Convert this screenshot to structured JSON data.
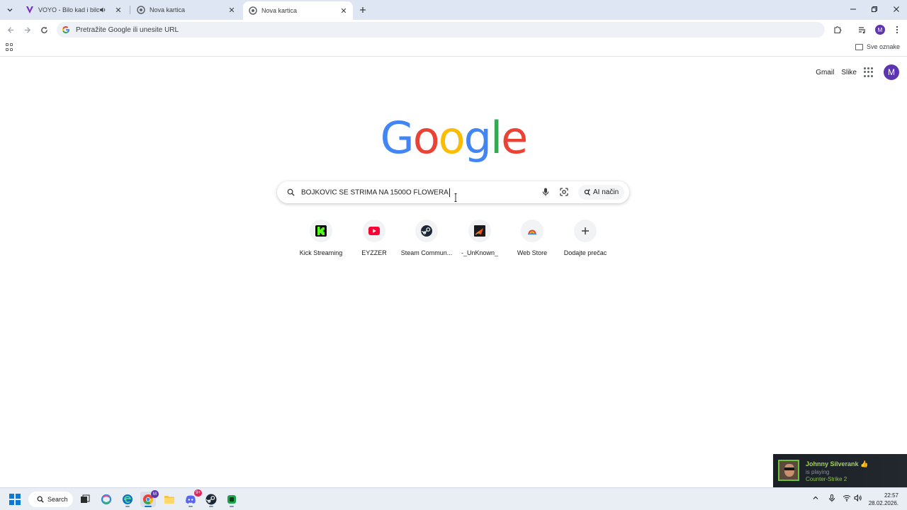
{
  "browser": {
    "tabs": [
      {
        "title": "VOYO - Bilo kad i bilo gdje",
        "active": false,
        "audio": true
      },
      {
        "title": "Nova kartica",
        "active": false,
        "audio": false
      },
      {
        "title": "Nova kartica",
        "active": true,
        "audio": false
      }
    ],
    "omnibox_placeholder": "Pretražite Google ili unesite URL",
    "all_bookmarks_label": "Sve oznake",
    "profile_initial": "M"
  },
  "google": {
    "logo_letters": [
      "G",
      "o",
      "o",
      "g",
      "l",
      "e"
    ],
    "logo_colors": [
      "#4285f4",
      "#ea4335",
      "#fbbc05",
      "#4285f4",
      "#34a853",
      "#ea4335"
    ],
    "gmail_label": "Gmail",
    "images_label": "Slike",
    "profile_initial": "M",
    "search_query": "BOJKOVIC SE STRIMA NA 1500O FLOWERA",
    "ai_mode_label": "AI način",
    "shortcuts": [
      {
        "label": "Kick Streaming",
        "icon": "kick-icon"
      },
      {
        "label": "EYZZER",
        "icon": "youtube-icon"
      },
      {
        "label": "Steam Commun...",
        "icon": "steam-icon"
      },
      {
        "label": "-_UnKnown_",
        "icon": "unknown-site-icon"
      },
      {
        "label": "Web Store",
        "icon": "web-store-icon"
      },
      {
        "label": "Dodajte prečac",
        "icon": "plus-icon"
      }
    ]
  },
  "notification": {
    "name": "Johnny Silverank",
    "status": "is playing",
    "game": "Counter-Strike 2"
  },
  "taskbar": {
    "search_label": "Search",
    "time": "22:57",
    "date": "28.02.2026.",
    "chrome_badge": "M",
    "discord_badge": "9+"
  }
}
